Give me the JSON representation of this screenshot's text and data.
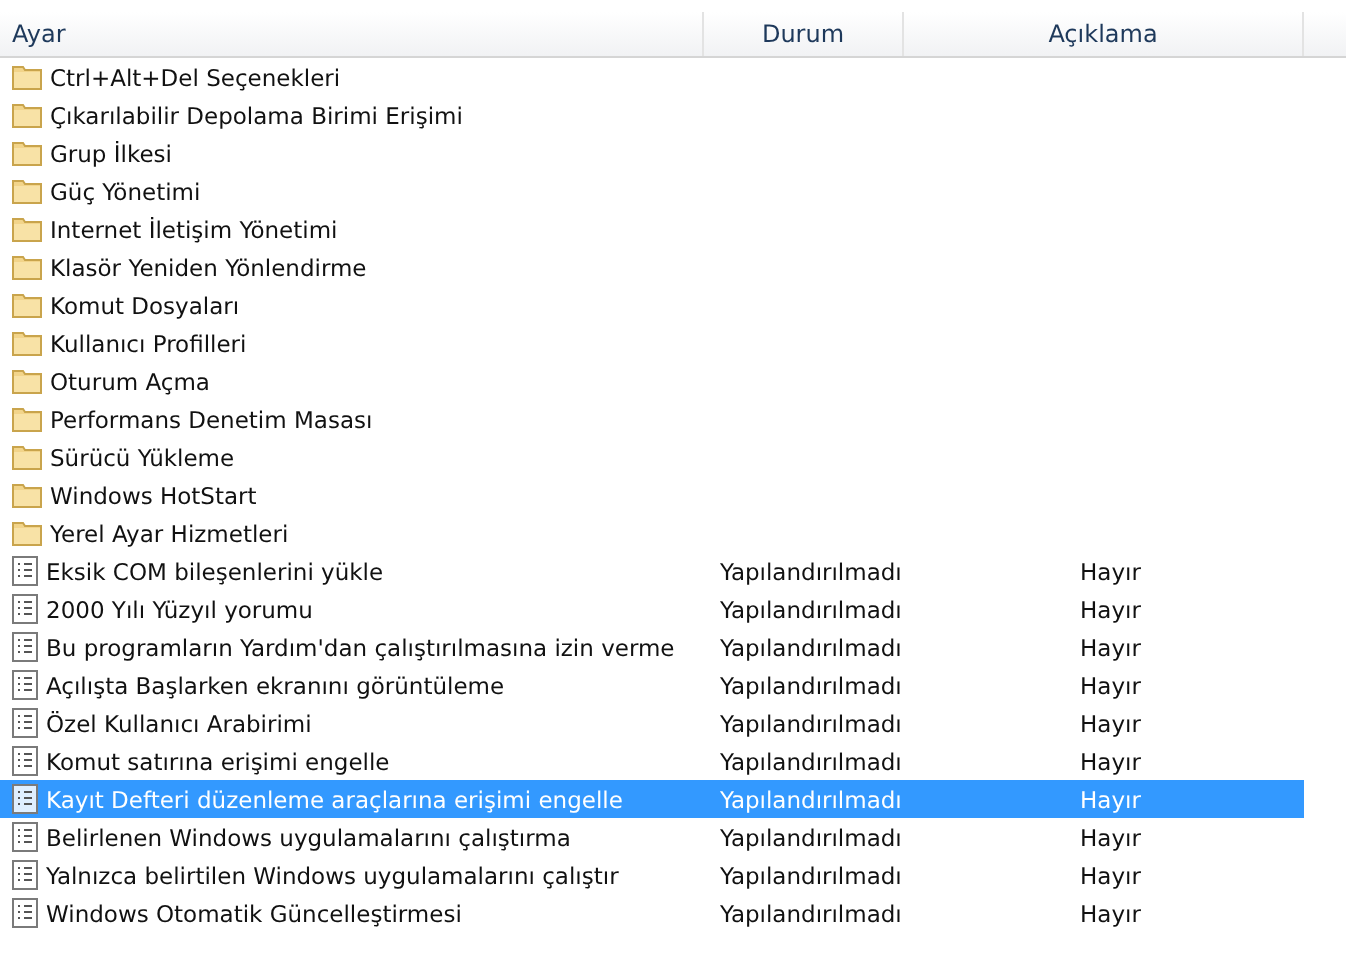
{
  "columns": [
    "Ayar",
    "Durum",
    "Açıklama"
  ],
  "rows": [
    {
      "kind": "folder",
      "name": "Ctrl+Alt+Del Seçenekleri",
      "selected": false
    },
    {
      "kind": "folder",
      "name": "Çıkarılabilir Depolama Birimi Erişimi",
      "selected": false
    },
    {
      "kind": "folder",
      "name": "Grup İlkesi",
      "selected": false
    },
    {
      "kind": "folder",
      "name": "Güç Yönetimi",
      "selected": false
    },
    {
      "kind": "folder",
      "name": "Internet İletişim Yönetimi",
      "selected": false
    },
    {
      "kind": "folder",
      "name": "Klasör Yeniden Yönlendirme",
      "selected": false
    },
    {
      "kind": "folder",
      "name": "Komut Dosyaları",
      "selected": false
    },
    {
      "kind": "folder",
      "name": "Kullanıcı Profilleri",
      "selected": false
    },
    {
      "kind": "folder",
      "name": "Oturum Açma",
      "selected": false
    },
    {
      "kind": "folder",
      "name": "Performans Denetim Masası",
      "selected": false
    },
    {
      "kind": "folder",
      "name": "Sürücü Yükleme",
      "selected": false
    },
    {
      "kind": "folder",
      "name": "Windows HotStart",
      "selected": false
    },
    {
      "kind": "folder",
      "name": "Yerel Ayar Hizmetleri",
      "selected": false
    },
    {
      "kind": "policy",
      "name": "Eksik COM bileşenlerini yükle",
      "state": "Yapılandırılmadı",
      "comment": "Hayır",
      "selected": false
    },
    {
      "kind": "policy",
      "name": "2000 Yılı Yüzyıl yorumu",
      "state": "Yapılandırılmadı",
      "comment": "Hayır",
      "selected": false
    },
    {
      "kind": "policy",
      "name": "Bu programların Yardım'dan çalıştırılmasına izin verme",
      "state": "Yapılandırılmadı",
      "comment": "Hayır",
      "selected": false
    },
    {
      "kind": "policy",
      "name": "Açılışta Başlarken ekranını görüntüleme",
      "state": "Yapılandırılmadı",
      "comment": "Hayır",
      "selected": false
    },
    {
      "kind": "policy",
      "name": "Özel Kullanıcı Arabirimi",
      "state": "Yapılandırılmadı",
      "comment": "Hayır",
      "selected": false
    },
    {
      "kind": "policy",
      "name": "Komut satırına erişimi engelle",
      "state": "Yapılandırılmadı",
      "comment": "Hayır",
      "selected": false
    },
    {
      "kind": "policy",
      "name": "Kayıt Defteri düzenleme araçlarına erişimi engelle",
      "state": "Yapılandırılmadı",
      "comment": "Hayır",
      "selected": true
    },
    {
      "kind": "policy",
      "name": "Belirlenen Windows uygulamalarını çalıştırma",
      "state": "Yapılandırılmadı",
      "comment": "Hayır",
      "selected": false
    },
    {
      "kind": "policy",
      "name": "Yalnızca belirtilen Windows uygulamalarını çalıştır",
      "state": "Yapılandırılmadı",
      "comment": "Hayır",
      "selected": false
    },
    {
      "kind": "policy",
      "name": "Windows Otomatik Güncelleştirmesi",
      "state": "Yapılandırılmadı",
      "comment": "Hayır",
      "selected": false
    }
  ]
}
